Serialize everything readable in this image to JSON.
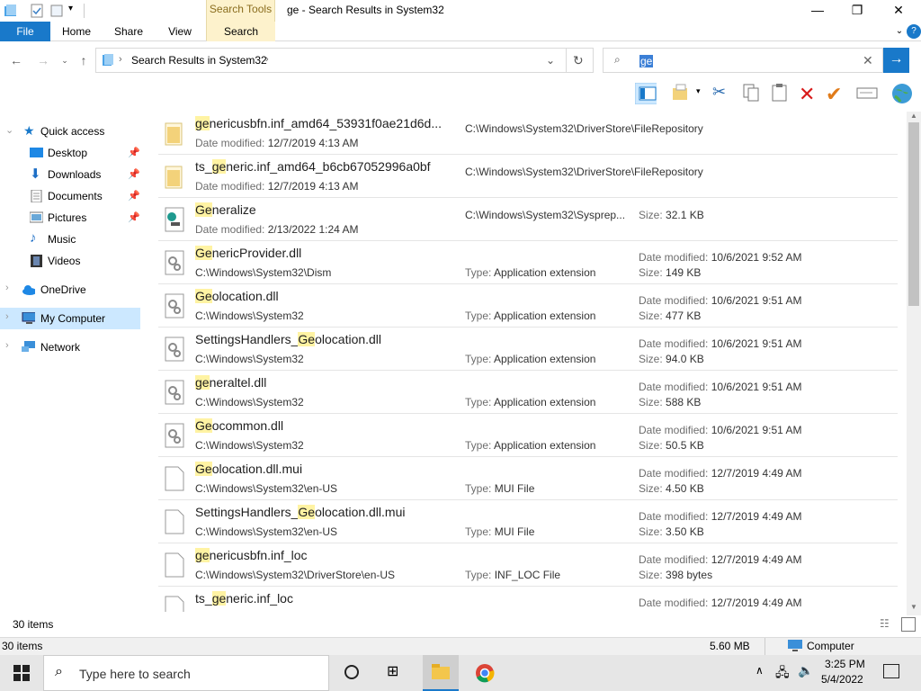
{
  "window": {
    "title": "ge - Search Results in System32",
    "context_tab": "Search Tools",
    "tabs": [
      "File",
      "Home",
      "Share",
      "View",
      "Search"
    ]
  },
  "nav": {
    "breadcrumb": "Search Results in System32",
    "search_value": "ge"
  },
  "sidebar": {
    "items": [
      {
        "label": "Quick access"
      },
      {
        "label": "Desktop"
      },
      {
        "label": "Downloads"
      },
      {
        "label": "Documents"
      },
      {
        "label": "Pictures"
      },
      {
        "label": "Music"
      },
      {
        "label": "Videos"
      },
      {
        "label": "OneDrive"
      },
      {
        "label": "My Computer"
      },
      {
        "label": "Network"
      }
    ]
  },
  "results": [
    {
      "pre": "",
      "hl": "ge",
      "post": "nericusbfn.inf_amd64_53931f0ae21d6d...",
      "sub_key": "Date modified:",
      "sub_val": "12/7/2019 4:13 AM",
      "path": "C:\\Windows\\System32\\DriverStore\\FileRepository",
      "icon": "folder"
    },
    {
      "pre": "ts_",
      "hl": "ge",
      "post": "neric.inf_amd64_b6cb67052996a0bf",
      "sub_key": "Date modified:",
      "sub_val": "12/7/2019 4:13 AM",
      "path": "C:\\Windows\\System32\\DriverStore\\FileRepository",
      "icon": "folder"
    },
    {
      "pre": "",
      "hl": "Ge",
      "post": "neralize",
      "sub_key": "Date modified:",
      "sub_val": "2/13/2022 1:24 AM",
      "path": "C:\\Windows\\System32\\Sysprep...",
      "size": "32.1 KB",
      "icon": "exe"
    },
    {
      "pre": "",
      "hl": "Ge",
      "post": "nericProvider.dll",
      "sub_val": "C:\\Windows\\System32\\Dism",
      "type": "Application extension",
      "date": "10/6/2021 9:52 AM",
      "size": "149 KB",
      "icon": "dll"
    },
    {
      "pre": "",
      "hl": "Ge",
      "post": "olocation.dll",
      "sub_val": "C:\\Windows\\System32",
      "type": "Application extension",
      "date": "10/6/2021 9:51 AM",
      "size": "477 KB",
      "icon": "dll"
    },
    {
      "pre": "SettingsHandlers_",
      "hl": "Ge",
      "post": "olocation.dll",
      "sub_val": "C:\\Windows\\System32",
      "type": "Application extension",
      "date": "10/6/2021 9:51 AM",
      "size": "94.0 KB",
      "icon": "dll"
    },
    {
      "pre": "",
      "hl": "ge",
      "post": "neraltel.dll",
      "sub_val": "C:\\Windows\\System32",
      "type": "Application extension",
      "date": "10/6/2021 9:51 AM",
      "size": "588 KB",
      "icon": "dll"
    },
    {
      "pre": "",
      "hl": "Ge",
      "post": "ocommon.dll",
      "sub_val": "C:\\Windows\\System32",
      "type": "Application extension",
      "date": "10/6/2021 9:51 AM",
      "size": "50.5 KB",
      "icon": "dll"
    },
    {
      "pre": "",
      "hl": "Ge",
      "post": "olocation.dll.mui",
      "sub_val": "C:\\Windows\\System32\\en-US",
      "type": "MUI File",
      "date": "12/7/2019 4:49 AM",
      "size": "4.50 KB",
      "icon": "file"
    },
    {
      "pre": "SettingsHandlers_",
      "hl": "Ge",
      "post": "olocation.dll.mui",
      "sub_val": "C:\\Windows\\System32\\en-US",
      "type": "MUI File",
      "date": "12/7/2019 4:49 AM",
      "size": "3.50 KB",
      "icon": "file"
    },
    {
      "pre": "",
      "hl": "ge",
      "post": "nericusbfn.inf_loc",
      "sub_val": "C:\\Windows\\System32\\DriverStore\\en-US",
      "type": "INF_LOC File",
      "date": "12/7/2019 4:49 AM",
      "size": "398 bytes",
      "icon": "file"
    },
    {
      "pre": "ts_",
      "hl": "ge",
      "post": "neric.inf_loc",
      "sub_val": "",
      "date": "12/7/2019 4:49 AM",
      "icon": "file"
    }
  ],
  "labels": {
    "date_modified": "Date modified:",
    "size": "Size:",
    "type": "Type:"
  },
  "status": {
    "item_count": "30 items",
    "bottom_count": "30 items",
    "total_size": "5.60 MB",
    "location": "Computer"
  },
  "taskbar": {
    "search_placeholder": "Type here to search",
    "time": "3:25 PM",
    "date": "5/4/2022"
  },
  "colors": {
    "accent": "#1979ca",
    "highlight": "#fff3a3",
    "selection": "#cce8ff",
    "context_tab": "#fdf2cc"
  }
}
